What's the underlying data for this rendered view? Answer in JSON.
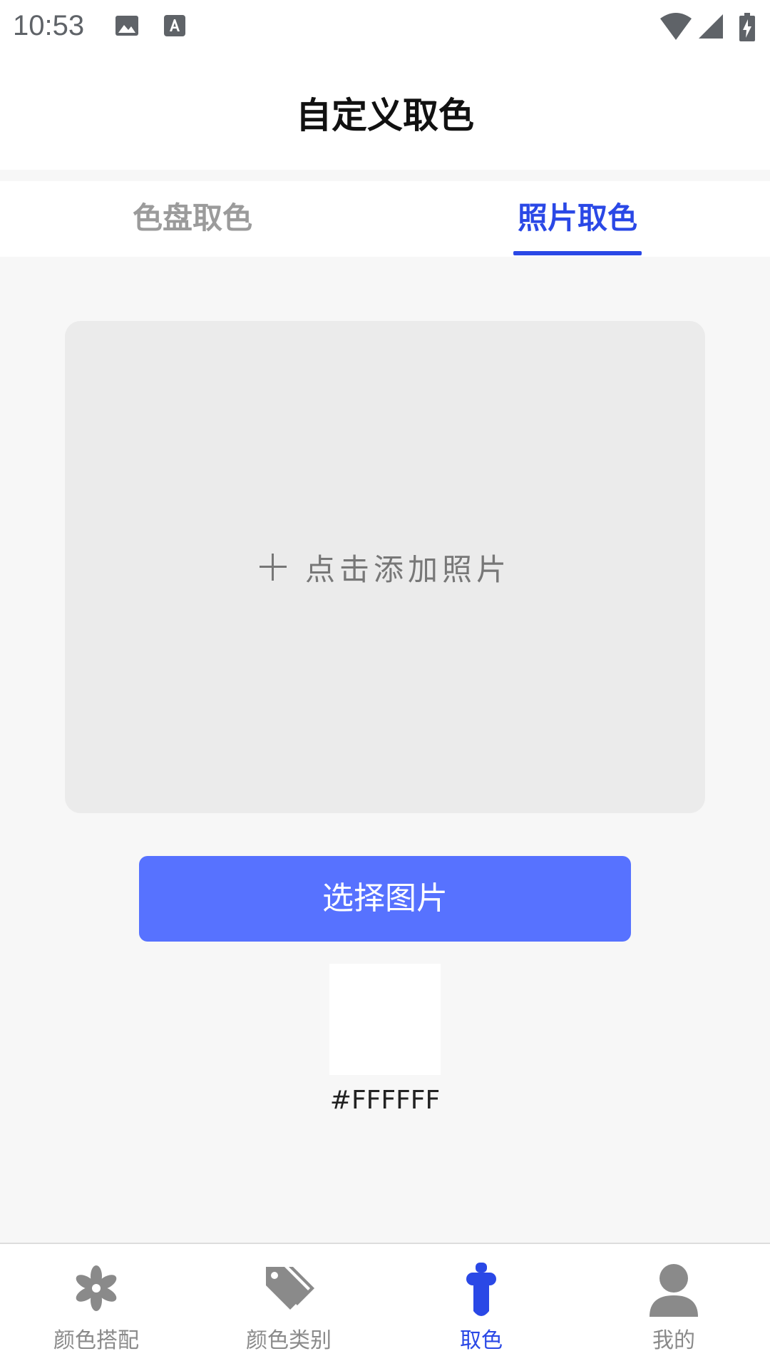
{
  "status_bar": {
    "time": "10:53"
  },
  "header": {
    "title": "自定义取色"
  },
  "tabs": [
    {
      "label": "色盘取色",
      "active": false
    },
    {
      "label": "照片取色",
      "active": true
    }
  ],
  "upload": {
    "label": "点击添加照片"
  },
  "actions": {
    "select_image_label": "选择图片"
  },
  "color_result": {
    "hex": "#FFFFFF"
  },
  "bottom_nav": [
    {
      "label": "颜色搭配",
      "icon": "flower-icon",
      "active": false
    },
    {
      "label": "颜色类别",
      "icon": "tag-icon",
      "active": false
    },
    {
      "label": "取色",
      "icon": "eyedropper-icon",
      "active": true
    },
    {
      "label": "我的",
      "icon": "person-icon",
      "active": false
    }
  ],
  "colors": {
    "accent": "#2a48e6",
    "button": "#5772ff",
    "inactive": "#9b9b9b"
  }
}
